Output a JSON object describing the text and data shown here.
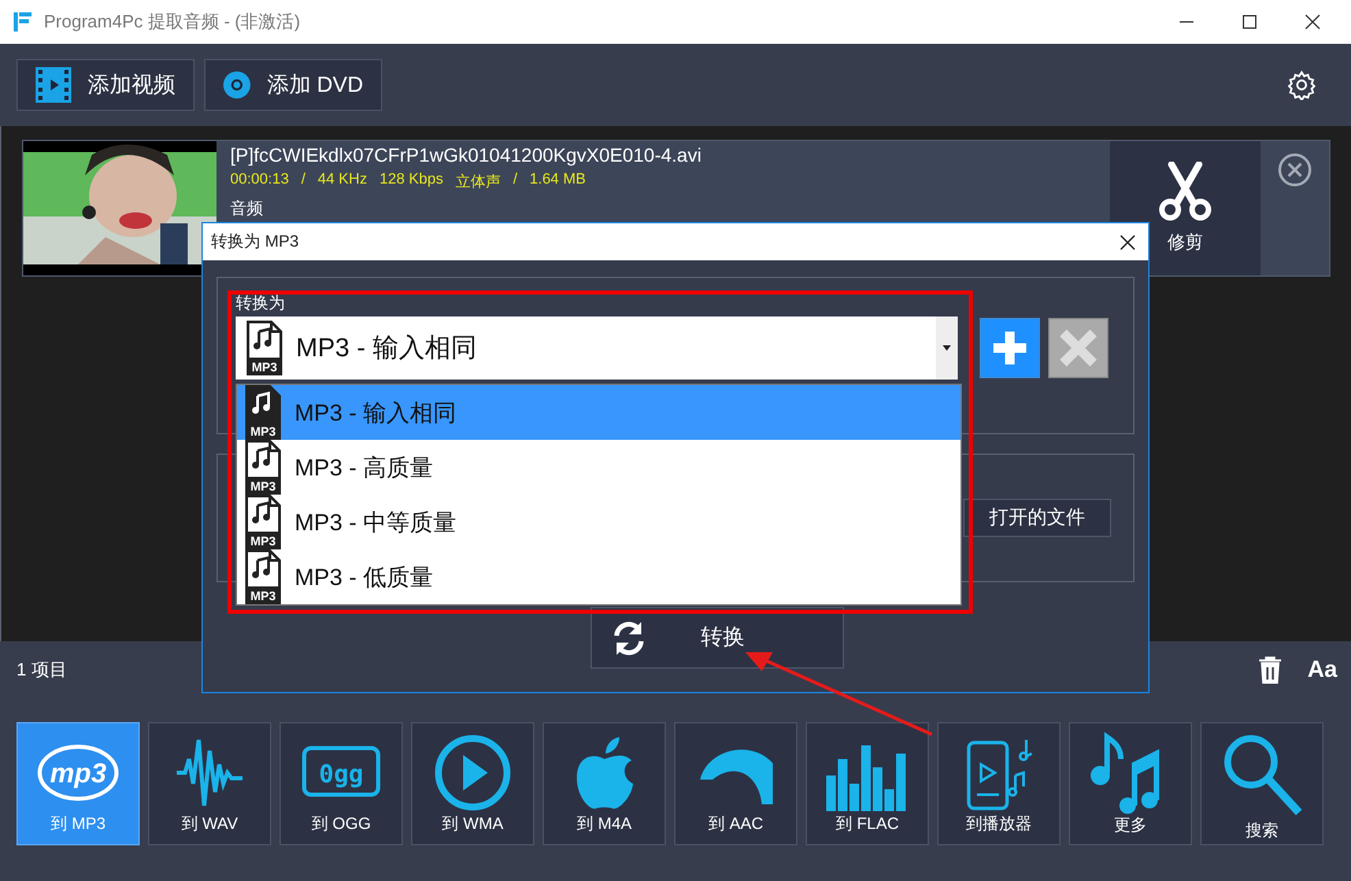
{
  "window": {
    "title": "Program4Pc 提取音频 - (非激活)"
  },
  "toolbar": {
    "buttons": [
      {
        "label": "添加视频",
        "kind": "video"
      },
      {
        "label": "添加 DVD",
        "kind": "dvd"
      }
    ]
  },
  "file": {
    "name": "[P]fcCWIEkdlx07CFrP1wGk01041200KgvX0E010-4.avi",
    "meta": [
      "00:00:13",
      "/",
      "44 KHz",
      "128 Kbps",
      "立体声",
      "/",
      "1.64 MB"
    ],
    "track": "音频",
    "trim_label": "修剪"
  },
  "status": {
    "count": "1 项目",
    "font_button": "Aa"
  },
  "formats": [
    {
      "label": "到 MP3",
      "kind": "mp3",
      "selected": true,
      "icon_text": "mp3"
    },
    {
      "label": "到 WAV",
      "kind": "wav",
      "selected": false
    },
    {
      "label": "到 OGG",
      "kind": "ogg",
      "selected": false,
      "icon_text": "0gg"
    },
    {
      "label": "到 WMA",
      "kind": "wma",
      "selected": false
    },
    {
      "label": "到 M4A",
      "kind": "m4a",
      "selected": false
    },
    {
      "label": "到 AAC",
      "kind": "aac",
      "selected": false
    },
    {
      "label": "到 FLAC",
      "kind": "flac",
      "selected": false
    },
    {
      "label": "到播放器",
      "kind": "player",
      "selected": false
    },
    {
      "label": "更多",
      "kind": "more",
      "selected": false
    },
    {
      "label": "搜索",
      "kind": "search",
      "selected": false
    }
  ],
  "dialog": {
    "title": "转换为 MP3",
    "group_label": "转换为",
    "combo": {
      "value": "MP3 - 输入相同",
      "icon_label": "MP3"
    },
    "options": [
      {
        "label": "MP3 - 输入相同",
        "icon_label": "MP3",
        "selected": true
      },
      {
        "label": "MP3 - 高质量",
        "icon_label": "MP3",
        "selected": false
      },
      {
        "label": "MP3 - 中等质量",
        "icon_label": "MP3",
        "selected": false
      },
      {
        "label": "MP3 - 低质量",
        "icon_label": "MP3",
        "selected": false
      }
    ],
    "open_file_button": "打开的文件",
    "convert_button": "转换"
  },
  "annotation": {
    "highlight": true,
    "arrow": true
  }
}
